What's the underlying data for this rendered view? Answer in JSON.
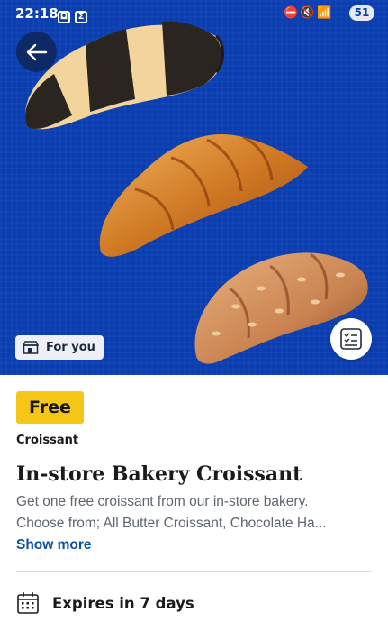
{
  "status_bar": {
    "time": "22:18",
    "battery": "51"
  },
  "hero": {
    "tag_label": "For you"
  },
  "offer": {
    "badge": "Free",
    "category": "Croissant",
    "title": "In-store Bakery Croissant",
    "description_line1": "Get one free croissant from our in-store bakery.",
    "description_line2": "Choose from; All Butter Croissant, Chocolate Ha...",
    "show_more": "Show more",
    "expires": "Expires in 7 days"
  },
  "colors": {
    "hero_bg": "#0a3eb0",
    "badge": "#f5c518",
    "link": "#0a50a8"
  }
}
